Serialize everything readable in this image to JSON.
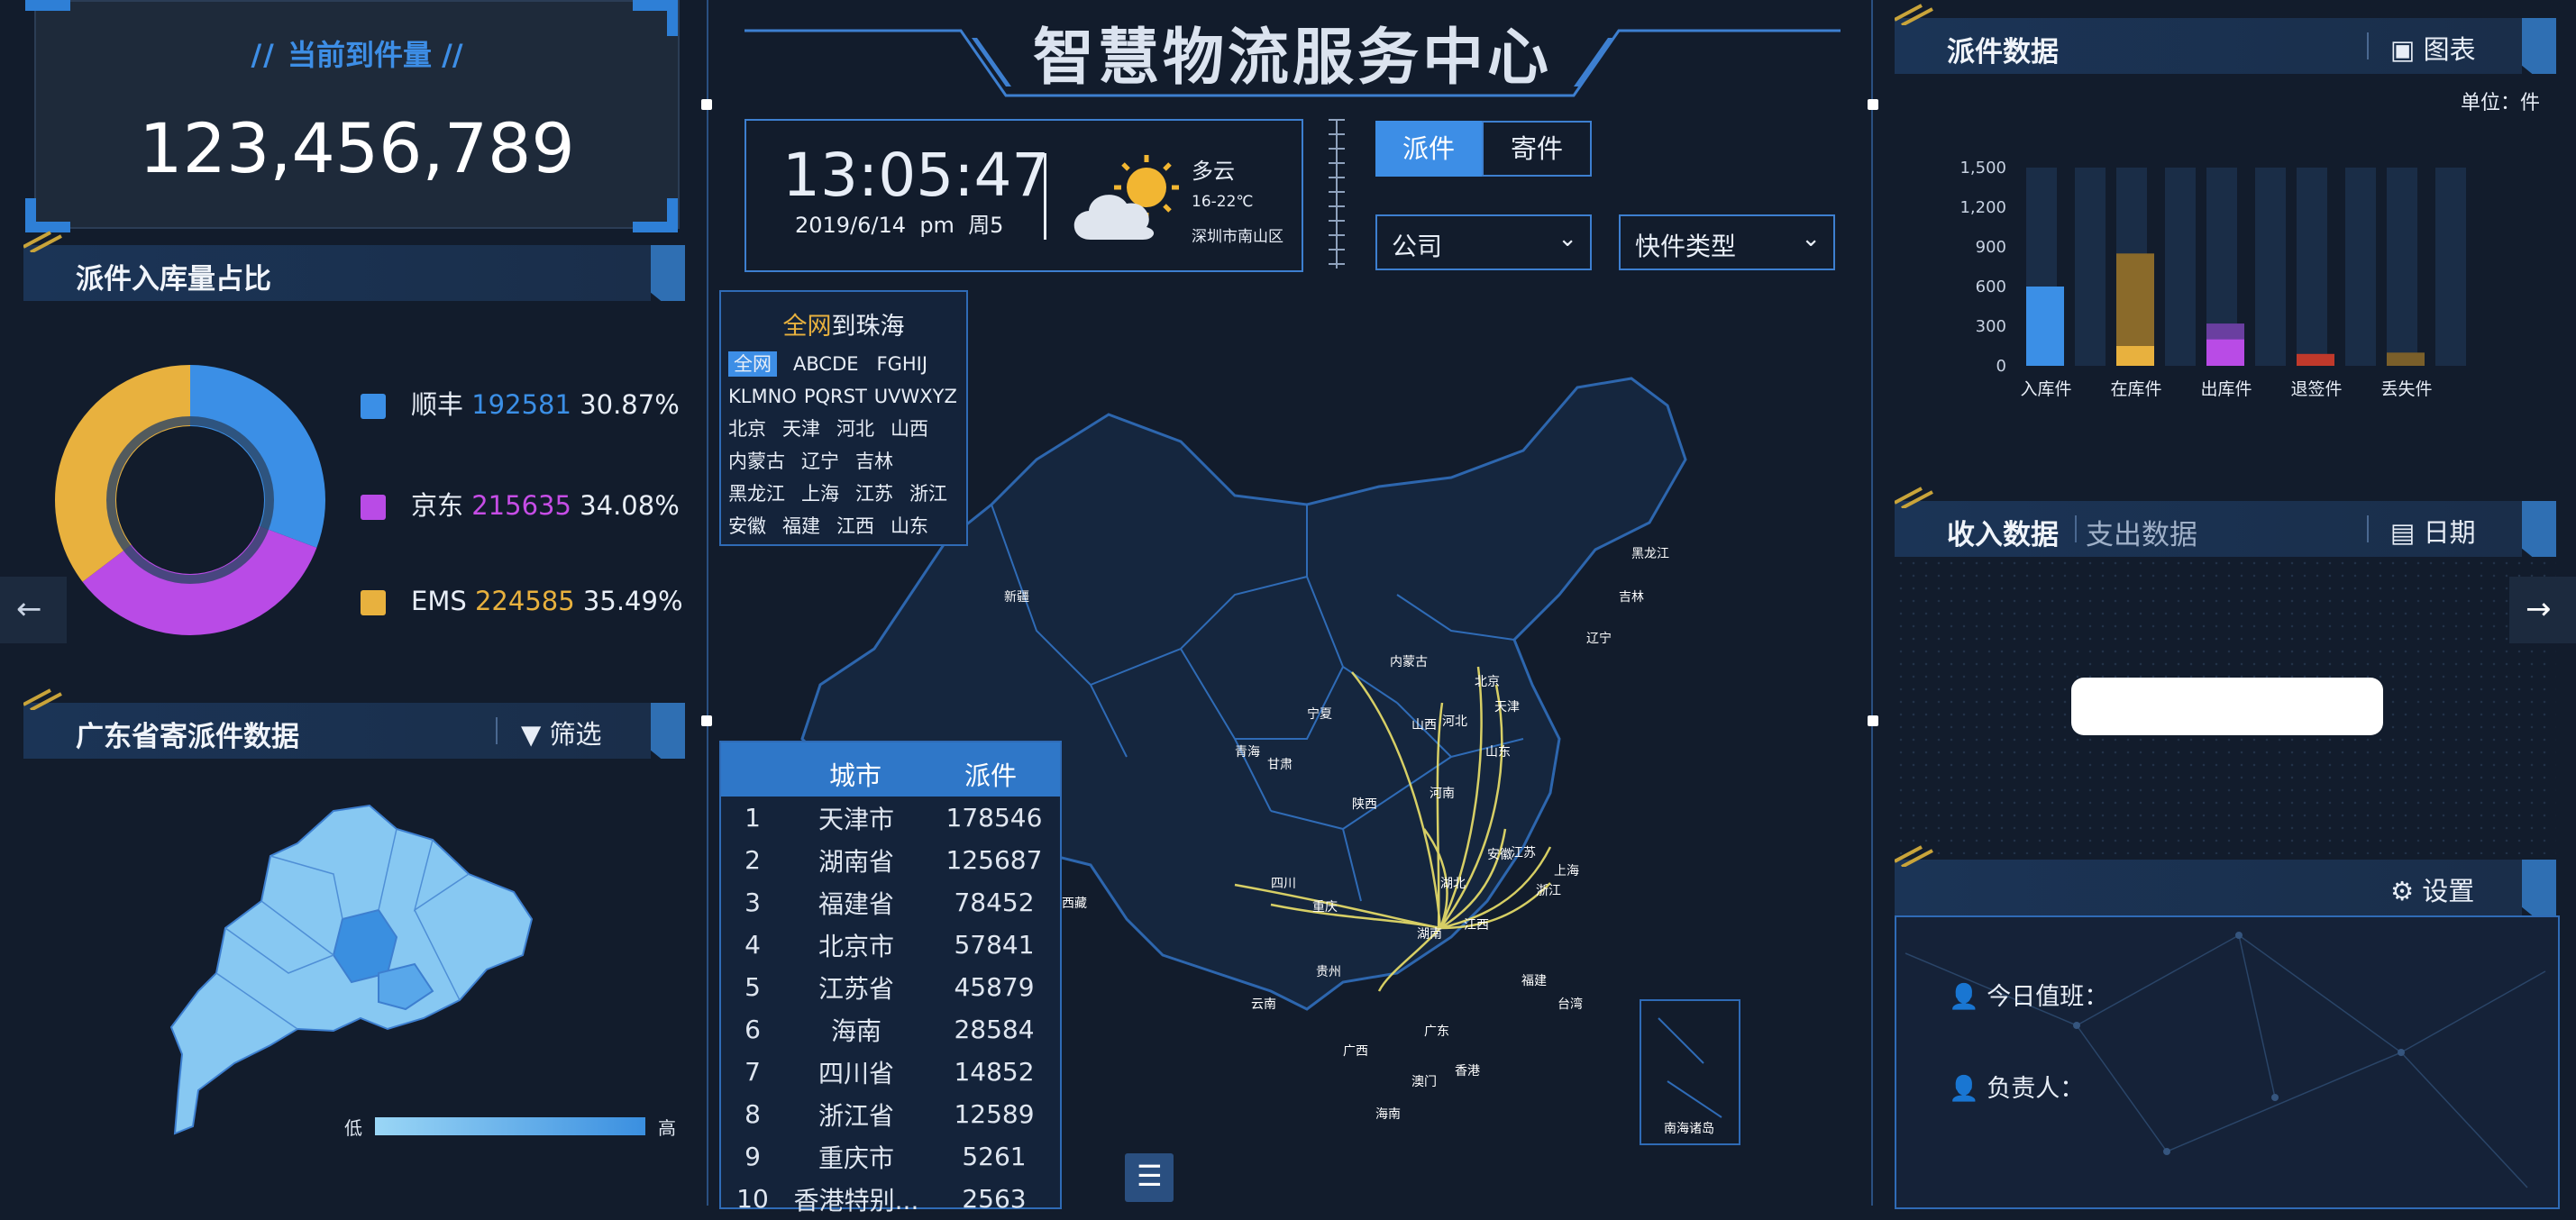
{
  "header": {
    "title": "智慧物流服务中心"
  },
  "left": {
    "arrival": {
      "label": "当前到件量",
      "value": "123,456,789"
    },
    "ratio": {
      "title": "派件入库量占比",
      "items": [
        {
          "name": "顺丰",
          "count": "192581",
          "pct": "30.87%",
          "color": "#3b8fe6",
          "value": 30.87
        },
        {
          "name": "京东",
          "count": "215635",
          "pct": "34.08%",
          "color": "#b94be6",
          "value": 34.08
        },
        {
          "name": "EMS",
          "count": "224585",
          "pct": "35.49%",
          "color": "#e8b13e",
          "value": 35.49
        }
      ]
    },
    "guangdong": {
      "title": "广东省寄派件数据",
      "filter_label": "筛选",
      "legend_low": "低",
      "legend_high": "高"
    }
  },
  "center": {
    "time": "13:05:47",
    "date": "2019/6/14  pm  周5",
    "weather": {
      "desc": "多云",
      "temp": "16-22℃",
      "location": "深圳市南山区"
    },
    "tabs": [
      {
        "label": "派件",
        "active": true
      },
      {
        "label": "寄件",
        "active": false
      }
    ],
    "dropdowns": [
      {
        "label": "公司"
      },
      {
        "label": "快件类型"
      }
    ],
    "route_filter": {
      "title_hl": "全网",
      "title_rest": "到珠海",
      "letters": [
        "全网",
        "ABCDE",
        "FGHIJ",
        "KLMNO",
        "PQRST",
        "UVWXYZ"
      ],
      "provinces": [
        [
          "北京",
          "天津",
          "河北",
          "山西"
        ],
        [
          "内蒙古",
          "辽宁",
          "吉林"
        ],
        [
          "黑龙江",
          "上海",
          "江苏",
          "浙江"
        ],
        [
          "安徽",
          "福建",
          "江西",
          "山东"
        ]
      ]
    },
    "city_table": {
      "headers": [
        "城市",
        "派件"
      ],
      "rows": [
        [
          "1",
          "天津市",
          "178546"
        ],
        [
          "2",
          "湖南省",
          "125687"
        ],
        [
          "3",
          "福建省",
          "78452"
        ],
        [
          "4",
          "北京市",
          "57841"
        ],
        [
          "5",
          "江苏省",
          "45879"
        ],
        [
          "6",
          "海南",
          "28584"
        ],
        [
          "7",
          "四川省",
          "14852"
        ],
        [
          "8",
          "浙江省",
          "12589"
        ],
        [
          "9",
          "重庆市",
          "5261"
        ],
        [
          "10",
          "香港特别...",
          "2563"
        ]
      ]
    },
    "map_labels": [
      "新疆",
      "西藏",
      "青海",
      "甘肃",
      "宁夏",
      "内蒙古",
      "北京",
      "天津",
      "河北",
      "山西",
      "山东",
      "陕西",
      "河南",
      "四川",
      "重庆",
      "湖北",
      "安徽",
      "江苏",
      "上海",
      "浙江",
      "湖南",
      "江西",
      "福建",
      "台湾",
      "贵州",
      "云南",
      "广西",
      "广东",
      "香港",
      "澳门",
      "海南",
      "黑龙江",
      "吉林",
      "辽宁",
      "南海诸岛"
    ]
  },
  "right": {
    "parcel": {
      "title": "派件数据",
      "chart_btn": "图表",
      "unit": "单位：件",
      "chart_data": {
        "type": "bar",
        "categories": [
          "入库件",
          "在库件",
          "出库件",
          "退签件",
          "丢失件"
        ],
        "series": [
          {
            "values": [
              600,
              850,
              320,
              90,
              100
            ]
          }
        ],
        "ylim": [
          0,
          1500
        ],
        "yticks": [
          "0",
          "300",
          "600",
          "900",
          "1,200",
          "1,500"
        ]
      }
    },
    "income": {
      "tab_active": "收入数据",
      "tab_other": "支出数据",
      "date_btn": "日期"
    },
    "settings": {
      "btn": "设置",
      "duty_label": "今日值班：",
      "owner_label": "负责人："
    }
  }
}
